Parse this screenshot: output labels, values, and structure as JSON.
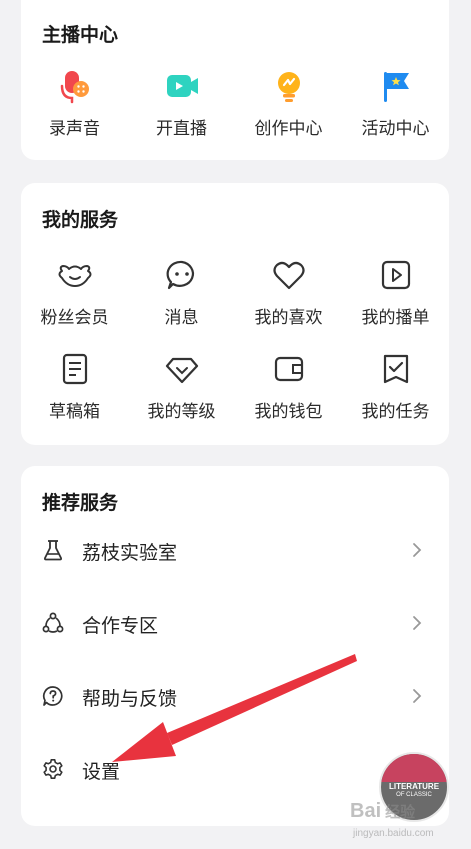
{
  "anchor_center": {
    "title": "主播中心",
    "items": [
      {
        "label": "录声音",
        "icon": "microphone-icon"
      },
      {
        "label": "开直播",
        "icon": "video-camera-icon"
      },
      {
        "label": "创作中心",
        "icon": "lightbulb-icon"
      },
      {
        "label": "活动中心",
        "icon": "flag-icon"
      }
    ]
  },
  "my_services": {
    "title": "我的服务",
    "items": [
      {
        "label": "粉丝会员",
        "icon": "fan-member-icon"
      },
      {
        "label": "消息",
        "icon": "message-icon"
      },
      {
        "label": "我的喜欢",
        "icon": "heart-icon"
      },
      {
        "label": "我的播单",
        "icon": "playlist-icon"
      },
      {
        "label": "草稿箱",
        "icon": "draft-icon"
      },
      {
        "label": "我的等级",
        "icon": "level-icon"
      },
      {
        "label": "我的钱包",
        "icon": "wallet-icon"
      },
      {
        "label": "我的任务",
        "icon": "task-icon"
      }
    ]
  },
  "recommended": {
    "title": "推荐服务",
    "items": [
      {
        "label": "荔枝实验室",
        "icon": "flask-icon"
      },
      {
        "label": "合作专区",
        "icon": "cooperation-icon"
      },
      {
        "label": "帮助与反馈",
        "icon": "help-icon"
      },
      {
        "label": "设置",
        "icon": "gear-icon"
      }
    ]
  },
  "floating_button": {
    "line1": "LITERATURE",
    "line2": "OF CLASSIC"
  },
  "watermark": {
    "brand": "Bai",
    "brand2": "经验",
    "url": "jingyan.baidu.com"
  },
  "colors": {
    "accent_red": "#e8333e",
    "text_dark": "#1a1a1a"
  }
}
